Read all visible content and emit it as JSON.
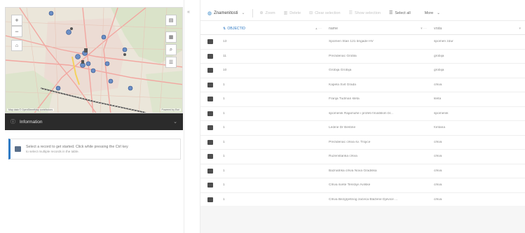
{
  "map": {
    "attribution_left": "Map data © OpenStreetMap contributors",
    "attribution_right": "Powered by Esri",
    "zoom_in": "+",
    "zoom_out": "−"
  },
  "info_panel": {
    "title": "Information",
    "message_line1": "Select a record to get started. Click while pressing the Ctrl key",
    "message_line2": "to select multiple records in the table."
  },
  "toolbar": {
    "layer": "Znamenitosti",
    "zoom": "Zoom",
    "delete": "Delete",
    "clear_selection": "Clear selection",
    "show_selection": "Show selection",
    "select_all": "Select all",
    "more": "More"
  },
  "table": {
    "columns": [
      "OBJECTID",
      "name",
      "vrsta"
    ],
    "rows": [
      {
        "id": "13",
        "name": "Spomen Stan 121 brigade HV",
        "type": "spomen zdur"
      },
      {
        "id": "11",
        "name": "Prezidenac Grobla",
        "type": "grobija"
      },
      {
        "id": "10",
        "name": "Grobija Grobija",
        "type": "grobija"
      },
      {
        "id": "1",
        "name": "Kapela Svit Grada",
        "type": "crkva"
      },
      {
        "id": "1",
        "name": "Franja Tudman kleta",
        "type": "kleta"
      },
      {
        "id": "1",
        "name": "spomenik Rajamuhe i profeti hrvatskim br...",
        "type": "spomenik"
      },
      {
        "id": "1",
        "name": "Ledine Dr Bestine",
        "type": "fontana"
      },
      {
        "id": "1",
        "name": "Prezidenac crkva sv. Trojice",
        "type": "crkva"
      },
      {
        "id": "1",
        "name": "Ruzenstanka crkva",
        "type": "crkva"
      },
      {
        "id": "1",
        "name": "Baznatrika crkva Nova Gradiska",
        "type": "crkva"
      },
      {
        "id": "1",
        "name": "Crkva svete Terezije Avilske",
        "type": "crkva"
      },
      {
        "id": "1",
        "name": "Crkva Bezgrješnog začeća Blažene Djevice ...",
        "type": "crkva"
      }
    ]
  },
  "colors": {
    "accent": "#2f7ac4",
    "info_bar": "#2b2b2b",
    "checkbox": "#4d4d4d"
  }
}
